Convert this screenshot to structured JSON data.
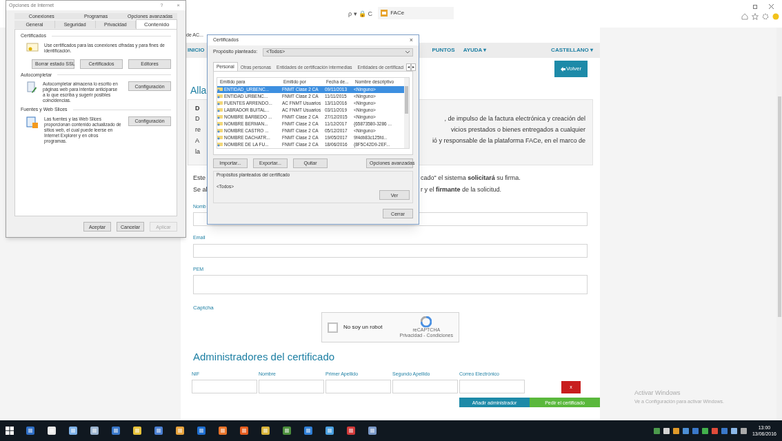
{
  "browser": {
    "address": "ρ ▾ 🔒 C",
    "tab_title": "FACe"
  },
  "page": {
    "tab_fragment": "de AC...",
    "nav": [
      {
        "label": "INICIO"
      },
      {
        "label": "PUNTOS"
      },
      {
        "label": "AYUDA ▾"
      }
    ],
    "language": "CASTELLANO ▾",
    "back_button": "Volver",
    "heading": "Alla",
    "notice": {
      "title": "D",
      "lines": [
        {
          "left": "D",
          "right": ", de impulso de la factura electrónica y creación del"
        },
        {
          "left": "re",
          "right": "vicios prestados o bienes entregados a cualquier"
        },
        {
          "left": "A",
          "right": "ió y responsable de la plataforma FACe, en el marco de"
        },
        {
          "left": "la"
        }
      ]
    },
    "intro_lines": [
      {
        "left": "Este",
        "right": "cado\" el sistema **solicitará** su firma."
      },
      {
        "left": "Se al",
        "right": "r y el **firmante** de la solicitud."
      }
    ],
    "fields": [
      {
        "label": "Nomb",
        "kind": "input"
      },
      {
        "label": "Email",
        "kind": "input"
      },
      {
        "label": "PEM",
        "kind": "textarea"
      }
    ],
    "captcha": {
      "label": "Captcha",
      "checkbox_label": "No soy un robot",
      "checked": false,
      "brand": "reCAPTCHA",
      "links": "Privacidad - Condiciones"
    },
    "admins": {
      "heading": "Administradores del certificado",
      "columns": [
        "NIF",
        "Nombre",
        "Primer Apellido",
        "Segundo Apellido",
        "Correo Electrónico"
      ],
      "remove_button": "x"
    },
    "actions": [
      {
        "label": "Añadir administrador",
        "kind": "primary"
      },
      {
        "label": "Pedir el certificado",
        "kind": "success"
      }
    ]
  },
  "internet_options": {
    "title": "Opciones de Internet",
    "help": "?",
    "close": "×",
    "tabs_back": [
      {
        "label": "Conexiones",
        "selected": false
      },
      {
        "label": "Programas",
        "selected": false
      },
      {
        "label": "Opciones avanzadas",
        "selected": false
      }
    ],
    "tabs_front": [
      {
        "label": "General",
        "selected": false
      },
      {
        "label": "Seguridad",
        "selected": false
      },
      {
        "label": "Privacidad",
        "selected": false
      },
      {
        "label": "Contenido",
        "selected": true
      }
    ],
    "sections": [
      {
        "title": "Certificados",
        "kind": "certificate",
        "text": "Use certificados para las conexiones cifradas y para fines de identificación.",
        "buttons": [
          "Borrar estado SSL",
          "Certificados",
          "Editores"
        ]
      },
      {
        "title": "Autocompletar",
        "kind": "autocomplete",
        "text": "Autocompletar almacena lo escrito en páginas web para intentar anticiparse a lo que escriba y sugerir posibles coincidencias.",
        "buttons": [
          "Configuración"
        ]
      },
      {
        "title": "Fuentes y Web Slices",
        "kind": "feeds",
        "text": "Las fuentes y las Web Slices proporcionan contenido actualizado de sitios web, el cual puede leerse en Internet Explorer y en otros programas.",
        "buttons": [
          "Configuración"
        ]
      }
    ],
    "footer": [
      {
        "label": "Aceptar",
        "disabled": false
      },
      {
        "label": "Cancelar",
        "disabled": false
      },
      {
        "label": "Aplicar",
        "disabled": true
      }
    ]
  },
  "certificates": {
    "title": "Certificados",
    "close": "×",
    "purpose_label": "Propósito planteado:",
    "purpose_value": "<Todos>",
    "tabs": [
      {
        "label": "Personal",
        "selected": true
      },
      {
        "label": "Otras personas",
        "selected": false
      },
      {
        "label": "Entidades de certificación intermedias",
        "selected": false
      },
      {
        "label": "Entidades de certificaci",
        "selected": false
      }
    ],
    "tab_scroll": [
      "◂",
      "▸"
    ],
    "columns": [
      "Emitido para",
      "Emitido por",
      "Fecha de...",
      "Nombre descriptivo"
    ],
    "rows": [
      {
        "cells": [
          "ENTIDAD_URBENC...",
          "FNMT Clase 2 CA",
          "09/11/2013",
          "<Ninguno>"
        ],
        "selected": true
      },
      {
        "cells": [
          "ENTIDAD URBENC...",
          "FNMT Clase 2 CA",
          "11/11/2015",
          "<Ninguno>"
        ],
        "selected": false
      },
      {
        "cells": [
          "FUENTES ARRENDO...",
          "AC FNMT Usuarios",
          "13/11/2016",
          "<Ninguno>"
        ],
        "selected": false
      },
      {
        "cells": [
          "LABRADOR BUITAL...",
          "AC FNMT Usuarios",
          "03/11/2019",
          "<Ninguno>"
        ],
        "selected": false
      },
      {
        "cells": [
          "NOMBRE BARBEDO ...",
          "FNMT Clase 2 CA",
          "27/12/2015",
          "<Ninguno>"
        ],
        "selected": false
      },
      {
        "cells": [
          "NOMBRE BERMAN...",
          "FNMT Clase 2 CA",
          "11/12/2017",
          "{65873580-3286 ..."
        ],
        "selected": false
      },
      {
        "cells": [
          "NOMBRE CASTRO ...",
          "FNMT Clase 2 CA",
          "05/12/2017",
          "<Ninguno>"
        ],
        "selected": false
      },
      {
        "cells": [
          "NOMBRE DACHATR...",
          "FNMT Clase 2 CA",
          "19/05/2017",
          "9f4db83c125fd..."
        ],
        "selected": false
      },
      {
        "cells": [
          "NOMBRE DE LA FU...",
          "FNMT Clase 2 CA",
          "18/06/2016",
          "{8F5C42D9-2EF..."
        ],
        "selected": false
      }
    ],
    "buttons": [
      "Importar...",
      "Exportar...",
      "Quitar"
    ],
    "advanced_button": "Opciones avanzadas",
    "purposes_label": "Propósitos planteados del certificado",
    "purposes_value": "<Todos>",
    "view_button": "Ver",
    "close_button": "Cerrar"
  },
  "activation": {
    "title": "Activar Windows",
    "subtitle": "Ve a Configuración para activar Windows."
  },
  "taskbar": {
    "time": "13:00",
    "date": "13/06/2016"
  }
}
